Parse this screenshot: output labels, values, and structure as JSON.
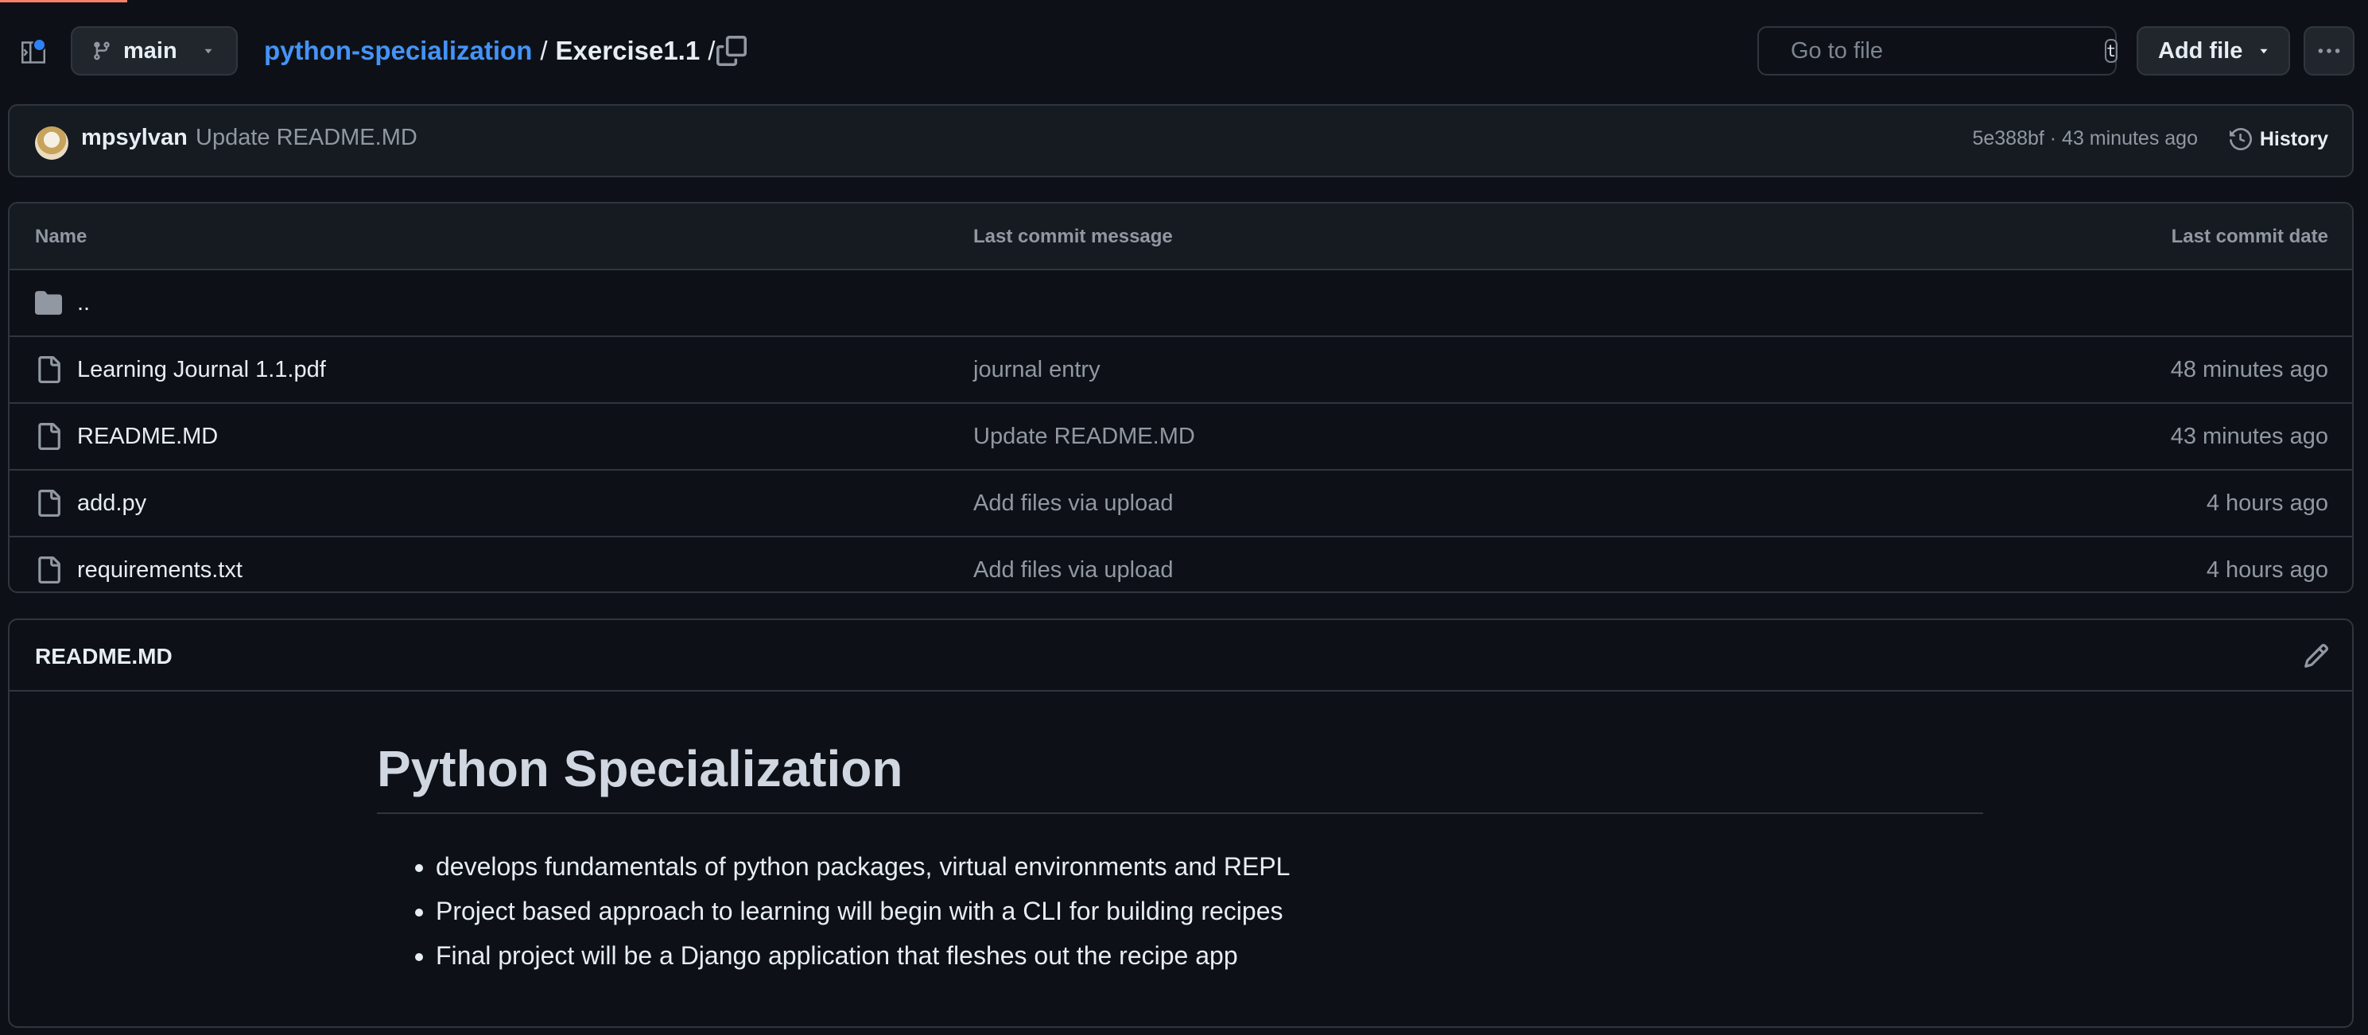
{
  "header": {
    "branch": "main",
    "repo": "python-specialization",
    "separator": "/",
    "directory": "Exercise1.1",
    "trailing_separator": "/",
    "search_placeholder": "Go to file",
    "search_shortcut": "t",
    "add_file_label": "Add file"
  },
  "commit": {
    "author": "mpsylvan",
    "message": "Update README.MD",
    "meta": "5e388bf · 43 minutes ago",
    "history_label": "History"
  },
  "files": {
    "columns": {
      "name": "Name",
      "message": "Last commit message",
      "date": "Last commit date"
    },
    "parent": "..",
    "rows": [
      {
        "name": "Learning Journal 1.1.pdf",
        "message": "journal entry",
        "date": "48 minutes ago"
      },
      {
        "name": "README.MD",
        "message": "Update README.MD",
        "date": "43 minutes ago"
      },
      {
        "name": "add.py",
        "message": "Add files via upload",
        "date": "4 hours ago"
      },
      {
        "name": "requirements.txt",
        "message": "Add files via upload",
        "date": "4 hours ago"
      }
    ]
  },
  "readme": {
    "file_label": "README.MD",
    "heading": "Python Specialization",
    "bullets": [
      "develops fundamentals of python packages, virtual environments and REPL",
      "Project based approach to learning will begin with a CLI for building recipes",
      "Final project will be a Django application that fleshes out the recipe app"
    ]
  },
  "colors": {
    "background": "#0d1117",
    "link": "#4493f8",
    "border": "#30363d",
    "muted_text": "#9198a1"
  }
}
